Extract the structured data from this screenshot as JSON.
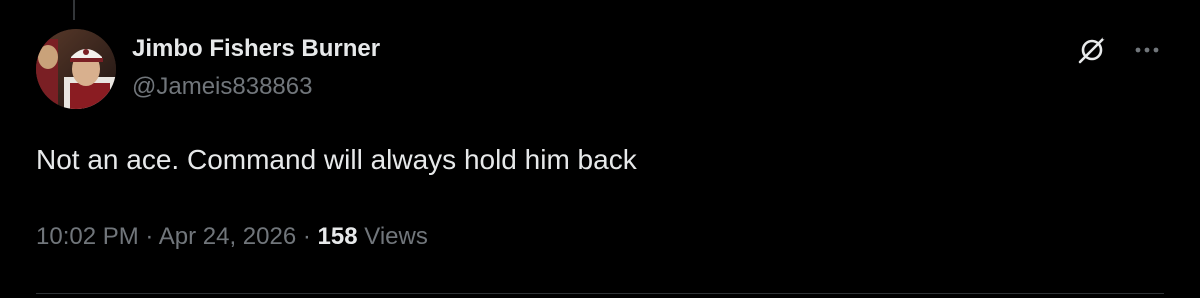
{
  "tweet": {
    "author": {
      "display_name": "Jimbo Fishers Burner",
      "handle": "@Jameis838863",
      "avatar_icon": "user-avatar-photo"
    },
    "text": "Not an ace. Command will always hold him back",
    "meta": {
      "time": "10:02 PM",
      "separator": "·",
      "date": "Apr 24, 2026",
      "views_count": "158",
      "views_label": "Views"
    },
    "actions": {
      "grok_icon": "grok-icon",
      "more_icon": "more-icon"
    }
  },
  "colors": {
    "background": "#000000",
    "primary_text": "#e7e9ea",
    "secondary_text": "#71767b",
    "divider": "#2f3336"
  }
}
